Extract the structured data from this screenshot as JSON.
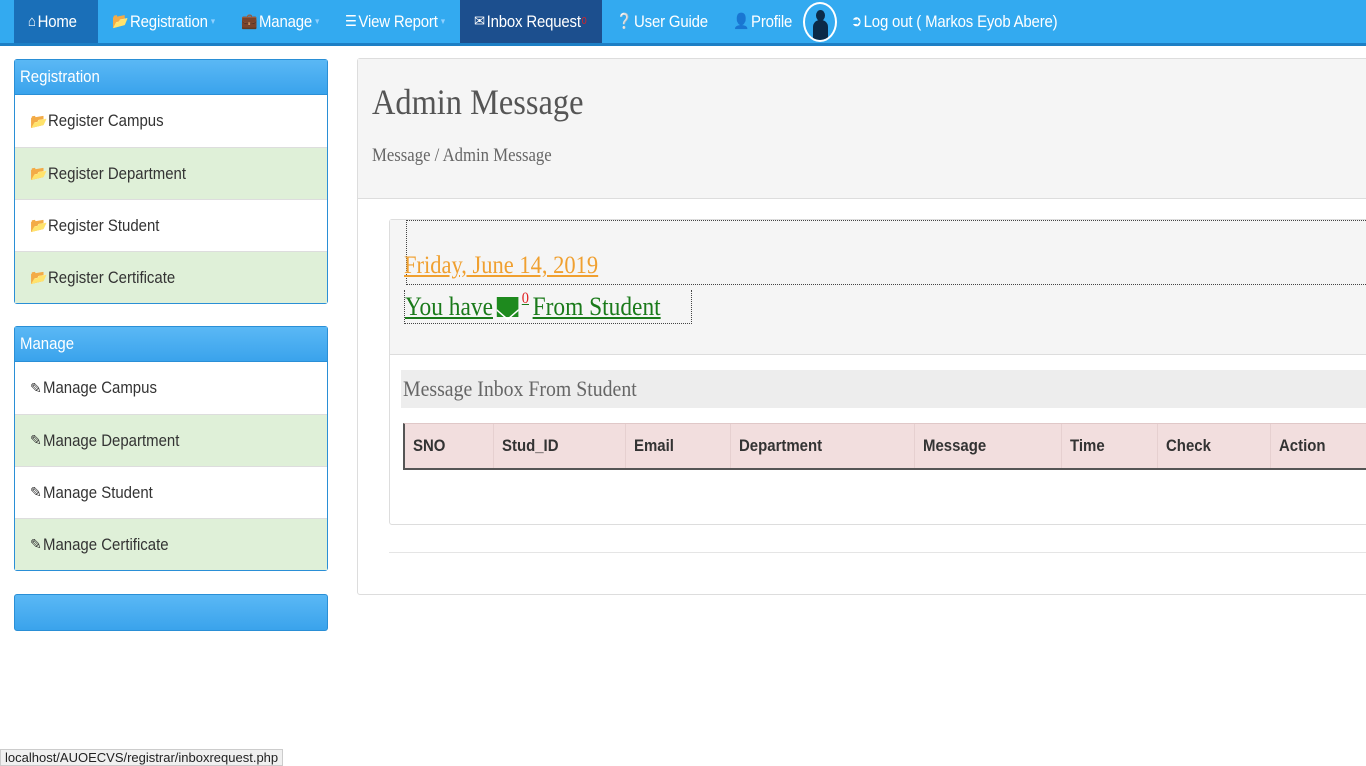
{
  "navbar": {
    "home": "Home",
    "registration": "Registration",
    "manage": "Manage",
    "view_report": "View Report",
    "inbox_request": "Inbox Request",
    "inbox_count": "0",
    "user_guide": "User Guide",
    "profile": "Profile",
    "logout": "Log out ( Markos Eyob Abere)"
  },
  "sidebar": {
    "registration_panel": {
      "heading": "Registration",
      "items": [
        {
          "label": "Register Campus"
        },
        {
          "label": "Register Department"
        },
        {
          "label": "Register Student"
        },
        {
          "label": "Register Certificate"
        }
      ]
    },
    "manage_panel": {
      "heading": "Manage",
      "items": [
        {
          "label": "Manage Campus"
        },
        {
          "label": "Manage Department"
        },
        {
          "label": "Manage Student"
        },
        {
          "label": "Manage Certificate"
        }
      ]
    }
  },
  "main": {
    "title": "Admin Message",
    "breadcrumb": "Message / Admin Message",
    "date": "Friday, June 14, 2019",
    "you_have_prefix": "You have",
    "message_count": "0",
    "you_have_suffix": "From Student",
    "section_title": "Message Inbox From Student",
    "table_columns": [
      "SNO",
      "Stud_ID",
      "Email",
      "Department",
      "Message",
      "Time",
      "Check",
      "Action"
    ]
  },
  "status_bar": "localhost/AUOECVS/registrar/inboxrequest.php",
  "colors": {
    "navbar": "#33aaf0",
    "active_tab": "#1a6fb8",
    "inbox_tab": "#1c4f8e",
    "date_link": "#f0a030",
    "message_link": "#1a7a1a",
    "table_header": "#f2dede",
    "sidebar_alt_row": "#dff0d8"
  },
  "icons": {
    "home": "home-icon",
    "registration": "folder-open-icon",
    "manage": "briefcase-icon",
    "view_report": "list-icon",
    "inbox": "envelope-icon",
    "user_guide": "question-circle-icon",
    "profile": "user-icon",
    "logout": "log-out-icon"
  }
}
